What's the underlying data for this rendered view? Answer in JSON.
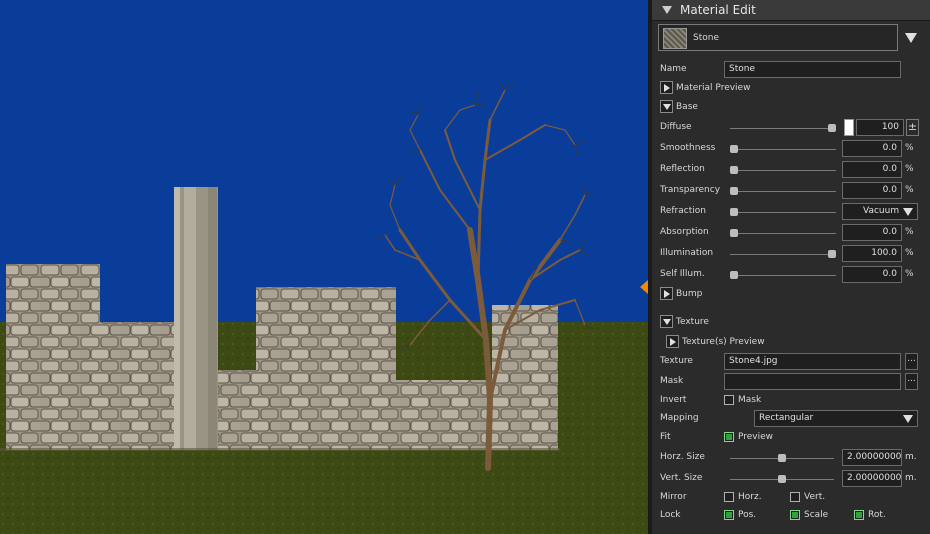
{
  "panel": {
    "title": "Material Edit",
    "selected_material": "Stone",
    "name_label": "Name",
    "name_value": "Stone",
    "sections": {
      "preview": "Material Preview",
      "base": "Base",
      "bump": "Bump",
      "texture": "Texture",
      "texture_preview": "Texture(s) Preview"
    },
    "diffuse": {
      "label": "Diffuse",
      "value": "100",
      "level": 1.0,
      "plusminus": "±"
    },
    "smoothness": {
      "label": "Smoothness",
      "value": "0.0",
      "unit": "%",
      "level": 0.0
    },
    "reflection": {
      "label": "Reflection",
      "value": "0.0",
      "unit": "%",
      "level": 0.0
    },
    "transparency": {
      "label": "Transparency",
      "value": "0.0",
      "unit": "%",
      "level": 0.0
    },
    "refraction": {
      "label": "Refraction",
      "value": "Vacuum",
      "level": 0.0
    },
    "absorption": {
      "label": "Absorption",
      "value": "0.0",
      "unit": "%",
      "level": 0.0
    },
    "illumination": {
      "label": "Illumination",
      "value": "100.0",
      "unit": "%",
      "level": 1.0
    },
    "self_illum": {
      "label": "Self Illum.",
      "value": "0.0",
      "unit": "%",
      "level": 0.0
    },
    "texture_label": "Texture",
    "texture_value": "Stone4.jpg",
    "mask_label": "Mask",
    "mask_value": "",
    "browse": "...",
    "invert_label": "Invert",
    "invert_mask": {
      "label": "Mask",
      "checked": false
    },
    "mapping_label": "Mapping",
    "mapping_value": "Rectangular",
    "fit_label": "Fit",
    "fit_preview": {
      "label": "Preview",
      "checked": true
    },
    "horz_size": {
      "label": "Horz. Size",
      "value": "2.00000000",
      "unit": "m.",
      "level": 0.5
    },
    "vert_size": {
      "label": "Vert. Size",
      "value": "2.00000000",
      "unit": "m.",
      "level": 0.5
    },
    "mirror_label": "Mirror",
    "mirror_horz": {
      "label": "Horz.",
      "checked": false
    },
    "mirror_vert": {
      "label": "Vert.",
      "checked": false
    },
    "lock_label": "Lock",
    "lock_pos": {
      "label": "Pos.",
      "checked": true
    },
    "lock_scale": {
      "label": "Scale",
      "checked": true
    },
    "lock_rot": {
      "label": "Rot.",
      "checked": true
    }
  },
  "colors": {
    "sky": "#0a3d9a",
    "grass": "#3d4a14",
    "accent_green": "#2fa33a",
    "splitter_handle": "#f08a00"
  }
}
